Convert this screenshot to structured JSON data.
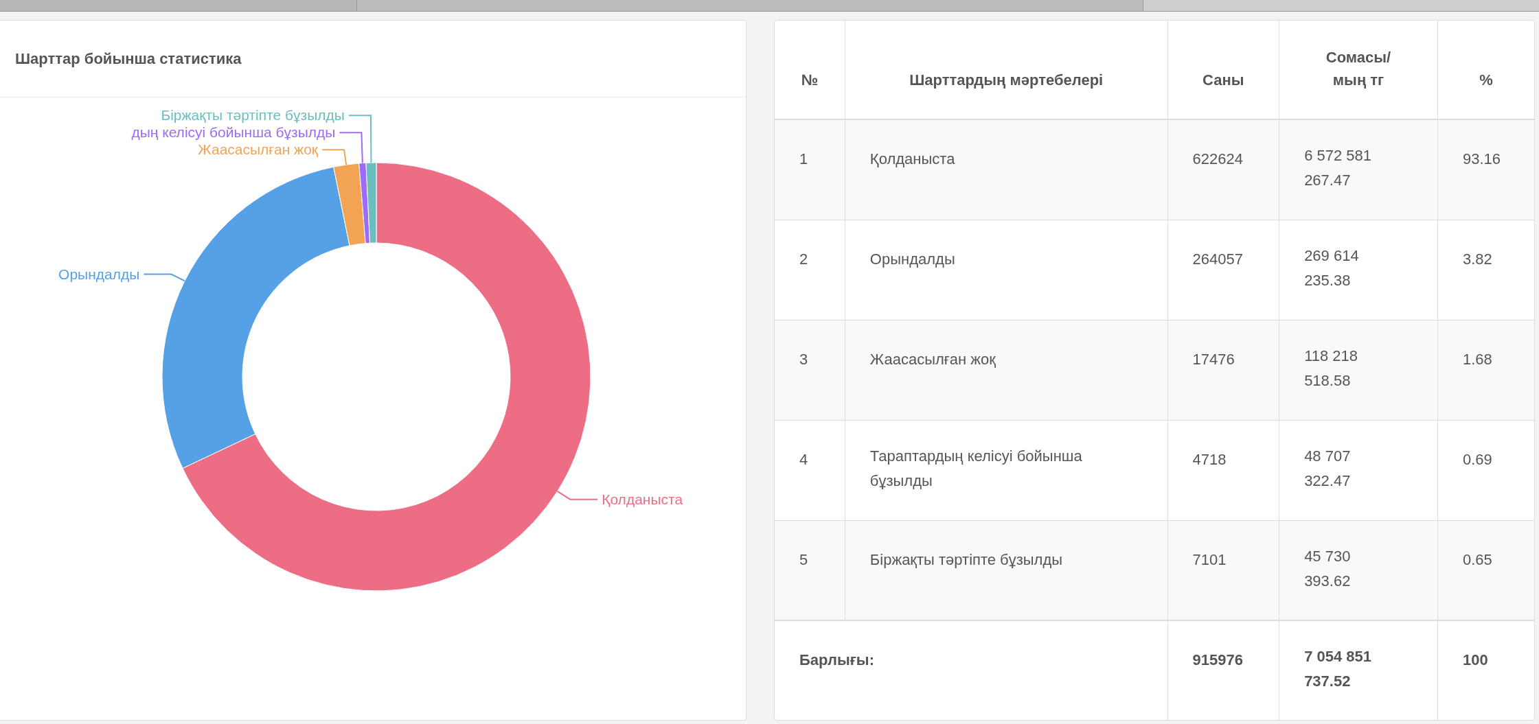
{
  "chart_panel": {
    "title": "Шарттар бойынша статистика",
    "chart_data": {
      "type": "donut",
      "categories": [
        "Қолданыста",
        "Орындалды",
        "Жаасасылған  жоқ",
        "дың келісуі бойынша бұзылды",
        "Біржақты тәртіпте бұзылды"
      ],
      "values": [
        67.97,
        28.83,
        1.91,
        0.52,
        0.77
      ],
      "colors": [
        "#ed6d85",
        "#56a0e5",
        "#f2a354",
        "#9c6cf8",
        "#6cbdbf"
      ]
    }
  },
  "table": {
    "columns": [
      "№",
      "Шарттардың мәртебелері",
      "Саны",
      "Сомасы/ мың тг",
      "%"
    ],
    "rows": [
      {
        "no": "1",
        "status": "Қолданыста",
        "count": "622624",
        "sum": "6 572 581 267.47",
        "percent": "93.16"
      },
      {
        "no": "2",
        "status": "Орындалды",
        "count": "264057",
        "sum": "269 614 235.38",
        "percent": "3.82"
      },
      {
        "no": "3",
        "status": "Жаасасылған жоқ",
        "count": "17476",
        "sum": "118 218 518.58",
        "percent": "1.68"
      },
      {
        "no": "4",
        "status": "Тараптардың келісуі бойынша бұзылды",
        "count": "4718",
        "sum": "48 707 322.47",
        "percent": "0.69"
      },
      {
        "no": "5",
        "status": "Біржақты тәртіпте бұзылды",
        "count": "7101",
        "sum": "45 730 393.62",
        "percent": "0.65"
      }
    ],
    "total": {
      "label": "Барлығы:",
      "count": "915976",
      "sum": "7 054 851 737.52",
      "percent": "100"
    }
  }
}
